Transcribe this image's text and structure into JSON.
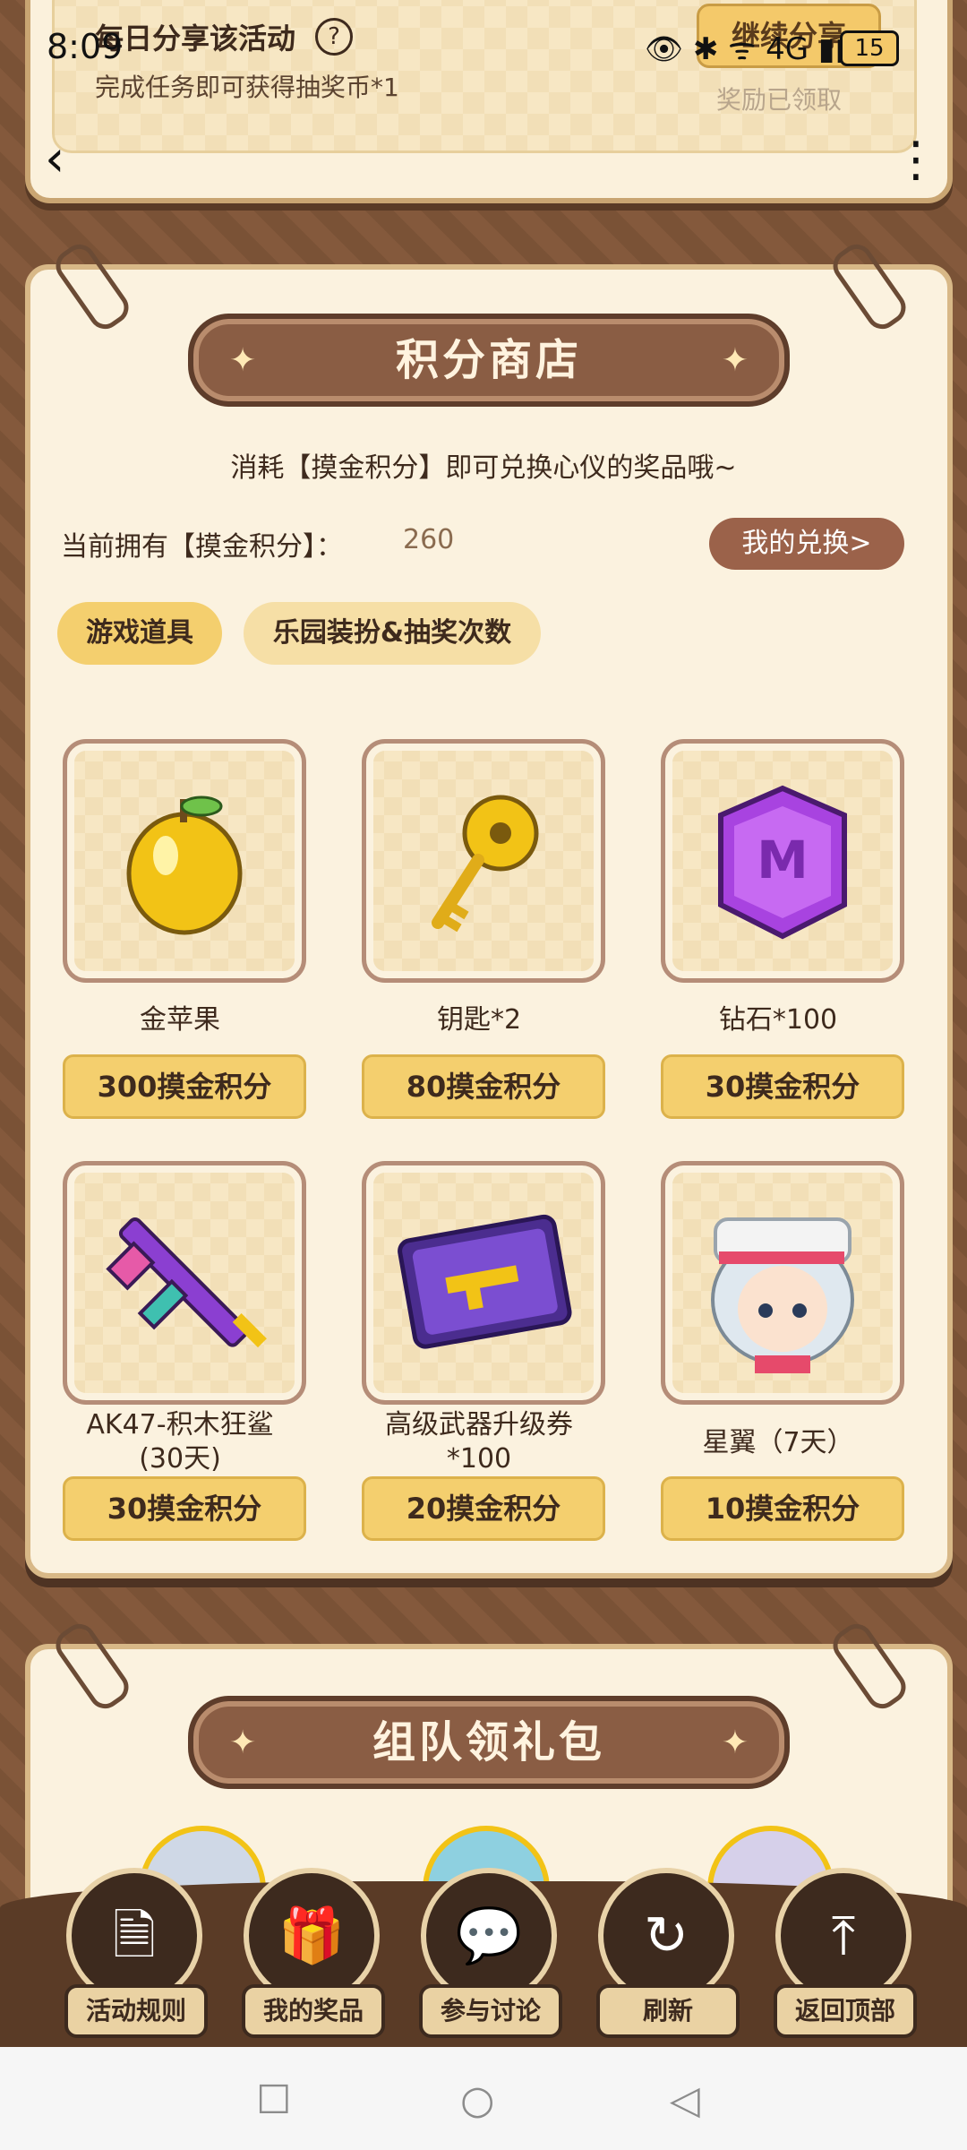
{
  "status_bar": {
    "time": "8:09",
    "battery": "15",
    "icons": "👁 ✱ ᯤ 4G ▮▮"
  },
  "top_card": {
    "title": "每日分享该活动",
    "subtitle": "完成任务即可获得抽奖币*1",
    "continue_label": "继续分享",
    "reward_status": "奖励已领取"
  },
  "nav_icons": {
    "back": "‹",
    "more": "⋮"
  },
  "shop": {
    "title": "积分商店",
    "description": "消耗【摸金积分】即可兑换心仪的奖品哦~",
    "points_label": "当前拥有【摸金积分】：",
    "points_value": "260",
    "my_exchange_label": "我的兑换>",
    "tabs": [
      {
        "label": "游戏道具",
        "active": true
      },
      {
        "label": "乐园装扮&抽奖次数",
        "active": false
      }
    ],
    "items": [
      {
        "name": "金苹果",
        "price": "300摸金积分",
        "icon": "golden-apple-icon"
      },
      {
        "name": "钥匙*2",
        "price": "80摸金积分",
        "icon": "golden-key-icon"
      },
      {
        "name": "钻石*100",
        "price": "30摸金积分",
        "icon": "diamond-icon"
      },
      {
        "name": "AK47-积木狂鲨\n(30天)",
        "price": "30摸金积分",
        "icon": "ak47-gun-icon"
      },
      {
        "name": "高级武器升级券\n*100",
        "price": "20摸金积分",
        "icon": "weapon-ticket-icon"
      },
      {
        "name": "星翼（7天）",
        "price": "10摸金积分",
        "icon": "character-avatar-icon"
      }
    ]
  },
  "team": {
    "title": "组队领礼包"
  },
  "bottom_nav": [
    {
      "label": "活动规则",
      "icon": "rules-icon"
    },
    {
      "label": "我的奖品",
      "icon": "gift-icon"
    },
    {
      "label": "参与讨论",
      "icon": "chat-icon"
    },
    {
      "label": "刷新",
      "icon": "refresh-icon"
    },
    {
      "label": "返回顶部",
      "icon": "back-to-top-icon"
    }
  ],
  "colors": {
    "accent": "#f4cf6e",
    "brown": "#8a5d44",
    "card": "#fbf2df"
  }
}
